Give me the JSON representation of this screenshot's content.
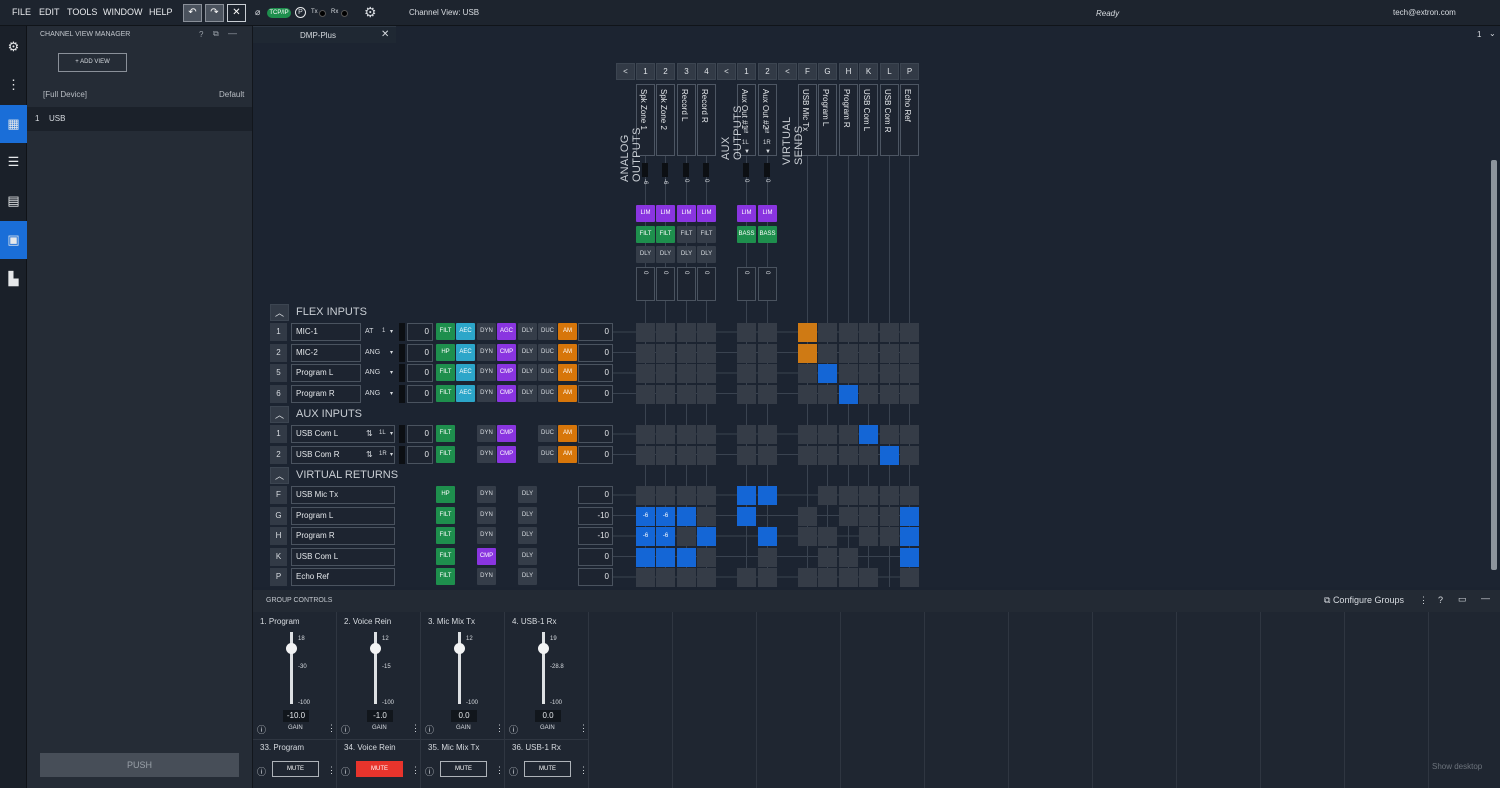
{
  "menu": {
    "file": "FILE",
    "edit": "EDIT",
    "tools": "TOOLS",
    "window": "WINDOW",
    "help": "HELP"
  },
  "toolbar": {
    "tcpip": "TCP/IP",
    "p": "P",
    "tx": "Tx",
    "rx": "Rx",
    "channel_view": "Channel View: USB",
    "status": "Ready",
    "user": "tech@extron.com"
  },
  "left": {
    "title": "CHANNEL VIEW MANAGER",
    "add_view": "ADD VIEW",
    "full_device": "[Full Device]",
    "default": "Default",
    "view_num": "1",
    "view_name": "USB",
    "push": "PUSH"
  },
  "tab": {
    "name": "DMP-Plus",
    "page": "1"
  },
  "sections": {
    "analog": "ANALOG OUTPUTS",
    "aux": "AUX OUTPUTS",
    "virtual": "VIRTUAL SENDS",
    "flex": "FLEX INPUTS",
    "auxin": "AUX INPUTS",
    "vret": "VIRTUAL RETURNS"
  },
  "columns": {
    "nums": [
      "1",
      "2",
      "3",
      "4",
      "1",
      "2",
      "F",
      "G",
      "H",
      "K",
      "L",
      "P"
    ],
    "names": [
      "Spk Zone 1",
      "Spk Zone 2",
      "Record L",
      "Record R",
      "Aux Out #1",
      "Aux Out #2",
      "USB Mic Tx",
      "Program L",
      "Program R",
      "USB Com L",
      "USB Com R",
      "Echo Ref"
    ],
    "levels": [
      "-6",
      "-6",
      "0",
      "0",
      "0",
      "0"
    ],
    "aux_sub": [
      "1L",
      "1R"
    ],
    "row1": [
      "LIM",
      "LIM",
      "LIM",
      "LIM",
      "LIM",
      "LIM"
    ],
    "row2": [
      "FILT",
      "FILT",
      "FILT",
      "FILT",
      "BASS",
      "BASS"
    ],
    "row3": [
      "DLY",
      "DLY",
      "DLY",
      "DLY"
    ],
    "out_vals": [
      "0",
      "0",
      "0",
      "0",
      "0",
      "0"
    ]
  },
  "flex_rows": [
    {
      "num": "1",
      "name": "MIC-1",
      "type": "AT",
      "sub": "1",
      "gain": "0",
      "procs": [
        "FILT",
        "AEC",
        "DYN",
        "AGC",
        "DLY",
        "DUC",
        "AM"
      ],
      "out": "0"
    },
    {
      "num": "2",
      "name": "MIC-2",
      "type": "ANG",
      "sub": "",
      "gain": "0",
      "procs": [
        "HP",
        "AEC",
        "DYN",
        "CMP",
        "DLY",
        "DUC",
        "AM"
      ],
      "out": "0"
    },
    {
      "num": "5",
      "name": "Program L",
      "type": "ANG",
      "sub": "",
      "gain": "0",
      "procs": [
        "FILT",
        "AEC",
        "DYN",
        "CMP",
        "DLY",
        "DUC",
        "AM"
      ],
      "out": "0"
    },
    {
      "num": "6",
      "name": "Program R",
      "type": "ANG",
      "sub": "",
      "gain": "0",
      "procs": [
        "FILT",
        "AEC",
        "DYN",
        "CMP",
        "DLY",
        "DUC",
        "AM"
      ],
      "out": "0"
    }
  ],
  "aux_rows": [
    {
      "num": "1",
      "name": "USB Com L",
      "sub": "1L",
      "gain": "0",
      "procs": [
        "FILT",
        "DYN",
        "CMP",
        "DUC",
        "AM"
      ],
      "out": "0"
    },
    {
      "num": "2",
      "name": "USB Com R",
      "sub": "1R",
      "gain": "0",
      "procs": [
        "FILT",
        "DYN",
        "CMP",
        "DUC",
        "AM"
      ],
      "out": "0"
    }
  ],
  "vret_rows": [
    {
      "num": "F",
      "name": "USB Mic Tx",
      "procs": [
        "HP",
        "DYN",
        "DLY"
      ],
      "out": "0"
    },
    {
      "num": "G",
      "name": "Program L",
      "procs": [
        "FILT",
        "DYN",
        "DLY"
      ],
      "out": "-10"
    },
    {
      "num": "H",
      "name": "Program R",
      "procs": [
        "FILT",
        "DYN",
        "DLY"
      ],
      "out": "-10"
    },
    {
      "num": "K",
      "name": "USB Com L",
      "procs": [
        "FILT",
        "CMP",
        "DLY"
      ],
      "out": "0"
    },
    {
      "num": "P",
      "name": "Echo Ref",
      "procs": [
        "FILT",
        "DYN",
        "DLY"
      ],
      "out": "0"
    }
  ],
  "matrix_labels": {
    "g1": "-6",
    "g2": "-6",
    "h1": "-6",
    "h2": "-6"
  },
  "group_controls": {
    "title": "GROUP CONTROLS",
    "configure": "Configure Groups"
  },
  "groups": [
    {
      "name": "1. Program",
      "ticks": [
        "18",
        "-30",
        "-100"
      ],
      "value": "-10.0",
      "gain": "GAIN",
      "mute_name": "33. Program",
      "mute": "MUTE",
      "level": 0.78
    },
    {
      "name": "2. Voice Rein",
      "ticks": [
        "12",
        "-15",
        "-100"
      ],
      "value": "-1.0",
      "gain": "GAIN",
      "mute_name": "34. Voice Rein",
      "mute": "MUTE",
      "level": 0.78
    },
    {
      "name": "3. Mic Mix Tx",
      "ticks": [
        "12",
        "-100"
      ],
      "value": "0.0",
      "gain": "GAIN",
      "mute_name": "35. Mic Mix Tx",
      "mute": "MUTE",
      "level": 0.78
    },
    {
      "name": "4. USB-1 Rx",
      "ticks": [
        "19",
        "-28.8",
        "-100"
      ],
      "value": "0.0",
      "gain": "GAIN",
      "mute_name": "36. USB-1 Rx",
      "mute": "MUTE",
      "level": 0.78
    }
  ],
  "show_desktop": "Show desktop",
  "colors": {
    "accent": "#1466d6",
    "mute_active": "#e8342c",
    "lim": "#8a35e0",
    "filt": "#1e8f4d",
    "aec": "#2ca6c9",
    "am": "#d7760a"
  }
}
